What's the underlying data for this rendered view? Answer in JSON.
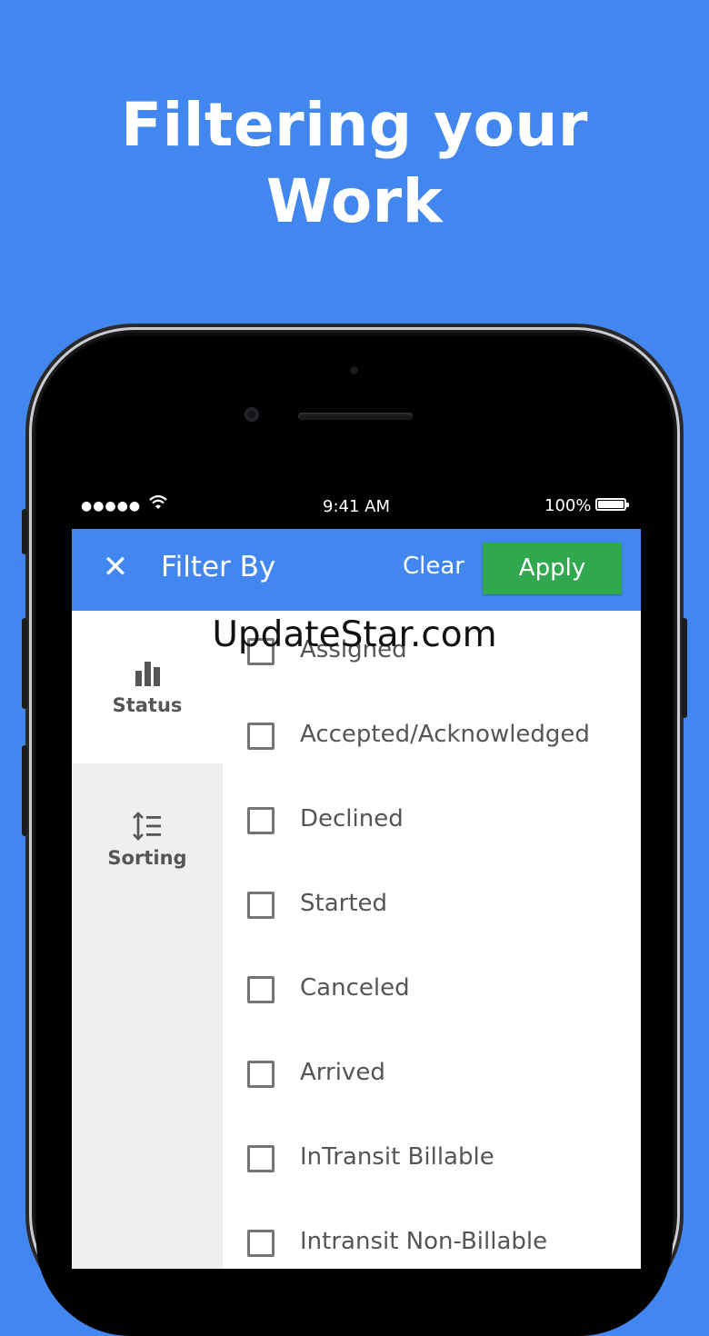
{
  "headline": {
    "line1": "Filtering your",
    "line2": "Work"
  },
  "status_bar": {
    "signal": "●●●●●",
    "time": "9:41 AM",
    "battery": "100%"
  },
  "app_bar": {
    "close": "✕",
    "title": "Filter By",
    "clear_label": "Clear",
    "apply_label": "Apply"
  },
  "sidebar": {
    "items": [
      {
        "label": "Status",
        "icon": "bar-chart-icon"
      },
      {
        "label": "Sorting",
        "icon": "sort-icon"
      }
    ]
  },
  "options": [
    {
      "label": "Assigned"
    },
    {
      "label": "Accepted/Acknowledged"
    },
    {
      "label": "Declined"
    },
    {
      "label": "Started"
    },
    {
      "label": "Canceled"
    },
    {
      "label": "Arrived"
    },
    {
      "label": "InTransit Billable"
    },
    {
      "label": "Intransit Non-Billable"
    }
  ],
  "watermark": "UpdateStar.com",
  "colors": {
    "background": "#4287f0",
    "apply": "#2fa84f",
    "sidebar": "#efefef"
  }
}
